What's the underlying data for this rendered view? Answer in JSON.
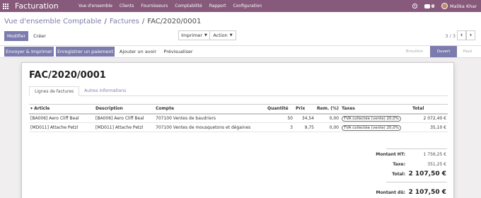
{
  "navbar": {
    "brand": "Facturation",
    "menu": [
      "Vue d'ensemble",
      "Clients",
      "Fournisseurs",
      "Comptabilité",
      "Rapport",
      "Configuration"
    ],
    "chat_count": "5",
    "user_name": "Malika Khar"
  },
  "breadcrumb": {
    "items": [
      "Vue d'ensemble Comptable",
      "Factures",
      "FAC/2020/0001"
    ],
    "separator": "/"
  },
  "control": {
    "edit_label": "Modifier",
    "create_label": "Créer",
    "print_label": "Imprimer",
    "action_label": "Action",
    "pager": "3 / 3"
  },
  "statusbar": {
    "send_print": "Envoyer & Imprimer",
    "register_payment": "Enregistrer un paiement",
    "add_credit_note": "Ajouter un avoir",
    "preview": "Prévisualiser",
    "stages": [
      "Brouillon",
      "Ouvert",
      "Payé"
    ],
    "current_stage": "Ouvert"
  },
  "invoice": {
    "title": "FAC/2020/0001",
    "tabs": [
      "Lignes de factures",
      "Autres informations"
    ],
    "columns": [
      "Article",
      "Description",
      "Compte",
      "Quantité",
      "Prix",
      "Rem. (%)",
      "Taxes",
      "Total"
    ],
    "lines": [
      {
        "article": "[BA006] Aero Cliff Beal",
        "description": "[BA006] Aero Cliff Beal",
        "account": "707100 Ventes de baudriers",
        "quantity": "50",
        "price": "34,54",
        "discount": "0,00",
        "tax": "TVA collectée (vente) 20,0%",
        "total": "2 072,40 €"
      },
      {
        "article": "[MD011] Attache Petzl",
        "description": "[MD011] Attache Petzl",
        "account": "707100 Ventes de mousquetons et dégaines",
        "quantity": "3",
        "price": "9,75",
        "discount": "0,00",
        "tax": "TVA collectée (vente) 20,0%",
        "total": "35,10 €"
      }
    ],
    "totals": {
      "untaxed_label": "Montant HT:",
      "untaxed": "1 756,25 €",
      "tax_label": "Taxe:",
      "tax": "351,25 €",
      "total_label": "Total:",
      "total": "2 107,50 €",
      "due_label": "Montant dû:",
      "due": "2 107,50 €"
    }
  },
  "colors": {
    "brand": "#875a7b",
    "primary": "#7c7bad",
    "background": "#f0eeee"
  }
}
